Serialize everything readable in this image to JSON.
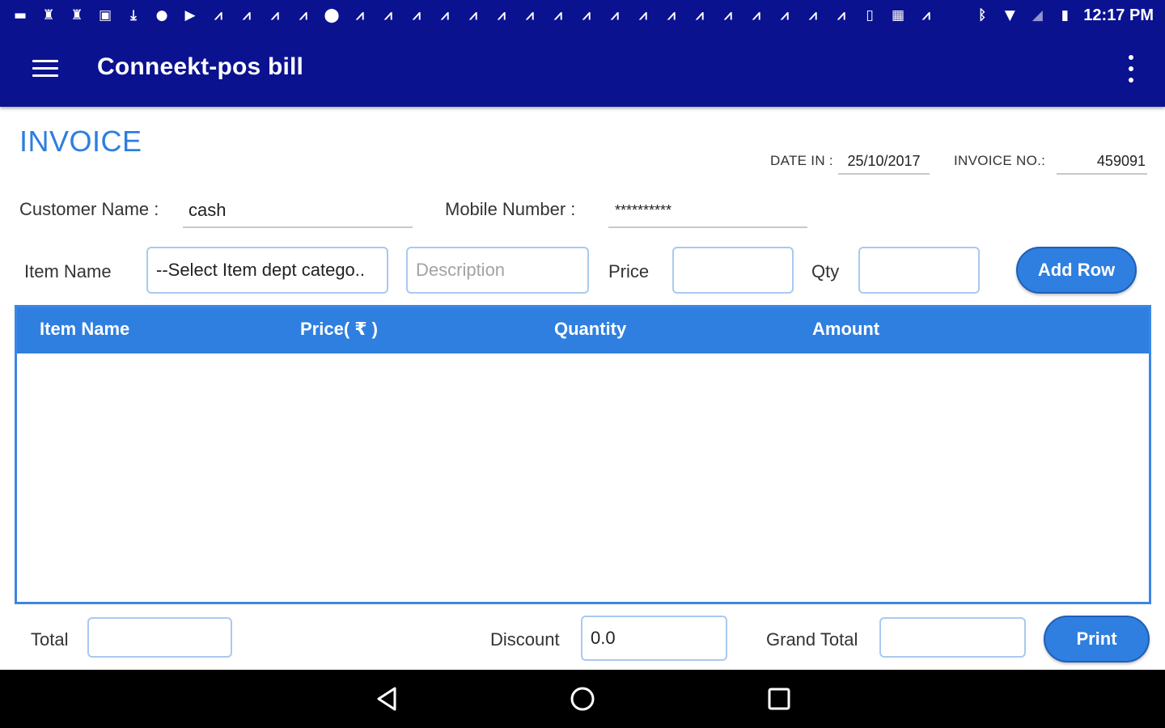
{
  "status_bar": {
    "time": "12:17 PM"
  },
  "app_bar": {
    "title": "Conneekt-pos bill"
  },
  "invoice": {
    "heading": "INVOICE",
    "date_label": "DATE IN :",
    "date_value": "25/10/2017",
    "invoice_no_label": "INVOICE NO.:",
    "invoice_no_value": "459091"
  },
  "customer": {
    "name_label": "Customer Name :",
    "name_value": "cash",
    "mobile_label": "Mobile Number :",
    "mobile_value": "**********"
  },
  "item_entry": {
    "item_name_label": "Item Name",
    "category_select": "--Select Item dept catego..",
    "description_placeholder": "Description",
    "price_label": "Price",
    "qty_label": "Qty",
    "add_row_button": "Add Row"
  },
  "table": {
    "columns": [
      "Item Name",
      "Price( ₹ )",
      "Quantity",
      "Amount"
    ],
    "rows": []
  },
  "footer": {
    "total_label": "Total",
    "discount_label": "Discount",
    "discount_value": "0.0",
    "grand_total_label": "Grand Total",
    "print_button": "Print"
  },
  "colors": {
    "primary_dark": "#0b1290",
    "accent_blue": "#2f7fe0"
  }
}
